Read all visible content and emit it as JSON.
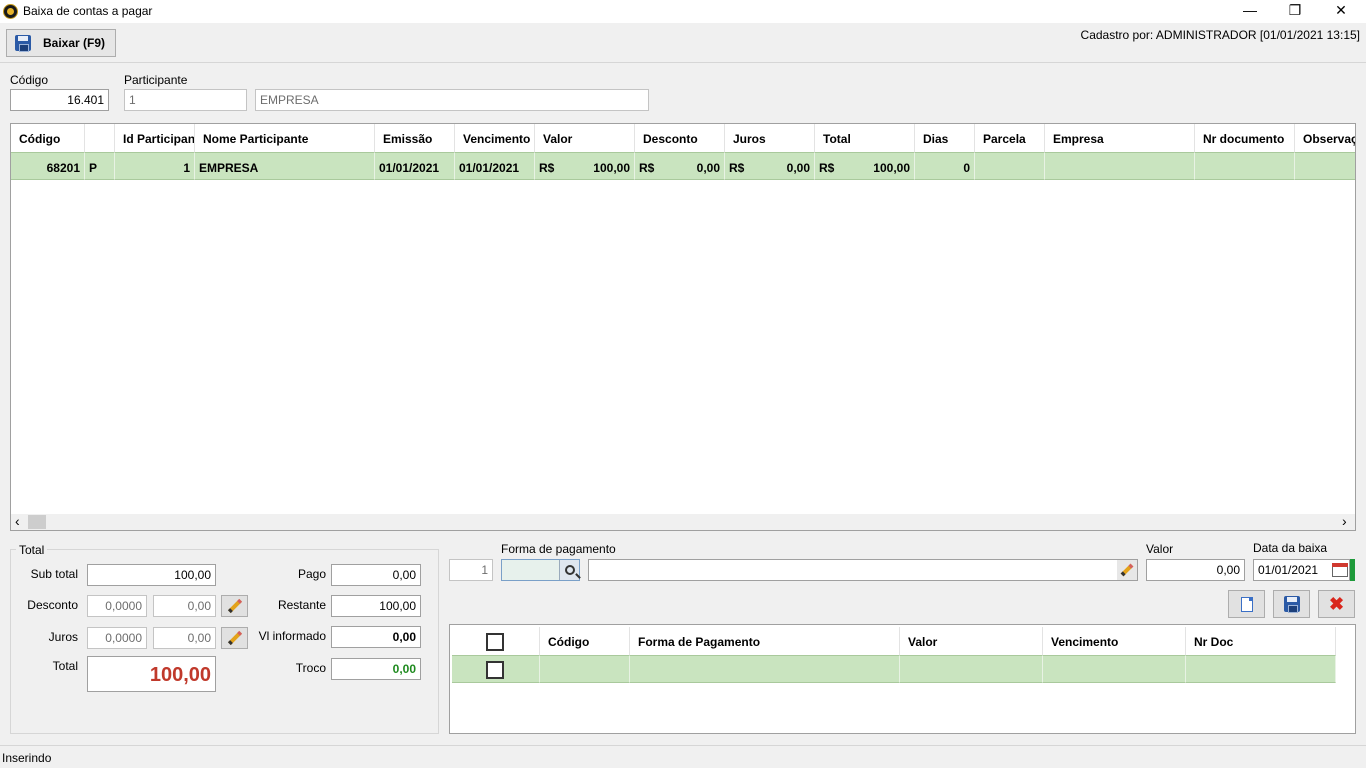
{
  "window": {
    "title": "Baixa de contas a pagar",
    "minimize": "—",
    "restore": "❐",
    "close": "✕"
  },
  "toolbar": {
    "baixar_label": "Baixar (F9)",
    "cadastro": "Cadastro por: ADMINISTRADOR [01/01/2021 13:15]"
  },
  "header": {
    "codigo_label": "Código",
    "codigo_value": "16.401",
    "participante_label": "Participante",
    "participante_id": "1",
    "participante_nome": "EMPRESA"
  },
  "grid": {
    "columns": [
      "Código",
      "",
      "Id Participan",
      "Nome Participante",
      "Emissão",
      "Vencimento",
      "Valor",
      "Desconto",
      "Juros",
      "Total",
      "Dias",
      "Parcela",
      "Empresa",
      "Nr documento",
      "Observaç"
    ],
    "rows": [
      {
        "codigo": "68201",
        "tipo": "P",
        "id_participante": "1",
        "nome": "EMPRESA",
        "emissao": "01/01/2021",
        "vencimento": "01/01/2021",
        "valor_cur": "R$",
        "valor": "100,00",
        "desconto_cur": "R$",
        "desconto": "0,00",
        "juros_cur": "R$",
        "juros": "0,00",
        "total_cur": "R$",
        "total": "100,00",
        "dias": "0",
        "parcela": "",
        "empresa": "",
        "nr_documento": "",
        "observacao": ""
      }
    ],
    "scroll_left": "‹",
    "scroll_right": "›"
  },
  "totals": {
    "legend": "Total",
    "subtotal_label": "Sub total",
    "subtotal": "100,00",
    "desconto_label": "Desconto",
    "desconto_pct": "0,0000",
    "desconto_val": "0,00",
    "juros_label": "Juros",
    "juros_pct": "0,0000",
    "juros_val": "0,00",
    "total_label": "Total",
    "total": "100,00",
    "pago_label": "Pago",
    "pago": "0,00",
    "restante_label": "Restante",
    "restante": "100,00",
    "informado_label": "Vl informado",
    "informado": "0,00",
    "troco_label": "Troco",
    "troco": "0,00"
  },
  "payment": {
    "seq": "1",
    "forma_label": "Forma de pagamento",
    "forma_code": "",
    "forma_desc": "",
    "valor_label": "Valor",
    "valor": "0,00",
    "data_label": "Data da baixa",
    "data": "01/01/2021",
    "columns": [
      "",
      "Código",
      "Forma de Pagamento",
      "Valor",
      "Vencimento",
      "Nr Doc"
    ]
  },
  "colors": {
    "row_selected": "#c9e4bf",
    "total_red": "#c0392b",
    "troco_green": "#1e8a1e"
  },
  "status": "Inserindo"
}
